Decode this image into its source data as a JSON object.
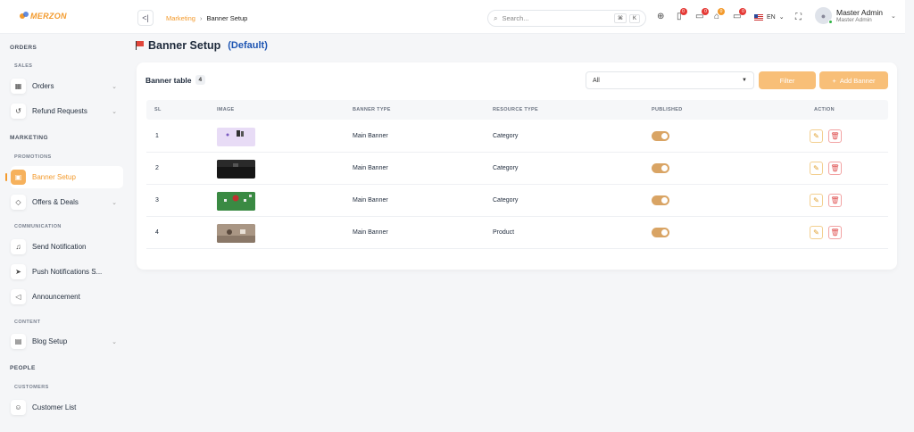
{
  "brand": {
    "name": "MERZON"
  },
  "breadcrumb": {
    "parent": "Marketing",
    "separator": "›",
    "current": "Banner Setup"
  },
  "search": {
    "placeholder": "Search...",
    "key1": "⌘",
    "key2": "K"
  },
  "notifications": {
    "cart_count": "0",
    "messages_count": "0",
    "store_count": "0",
    "card_count": "0"
  },
  "language": {
    "code": "EN"
  },
  "user": {
    "name": "Master Admin",
    "role": "Master Admin"
  },
  "sidebar": {
    "orders_section": "ORDERS",
    "sales_sub": "SALES",
    "orders": "Orders",
    "refund": "Refund Requests",
    "marketing_section": "MARKETING",
    "promotions_sub": "PROMOTIONS",
    "banner_setup": "Banner Setup",
    "offers": "Offers & Deals",
    "communication_sub": "COMMUNICATION",
    "send_notification": "Send Notification",
    "push_notifications": "Push Notifications S...",
    "announcement": "Announcement",
    "content_sub": "CONTENT",
    "blog_setup": "Blog Setup",
    "people_section": "PEOPLE",
    "customers_sub": "CUSTOMERS",
    "customer_list": "Customer List"
  },
  "page": {
    "title": "Banner Setup",
    "subtitle": "(Default)"
  },
  "table": {
    "title": "Banner table",
    "count": "4",
    "filter_value": "All",
    "filter_button": "Filter",
    "add_button": "Add Banner",
    "columns": [
      "SL",
      "IMAGE",
      "BANNER TYPE",
      "RESOURCE TYPE",
      "PUBLISHED",
      "ACTION"
    ],
    "rows": [
      {
        "sl": "1",
        "banner_type": "Main Banner",
        "resource_type": "Category",
        "published": true
      },
      {
        "sl": "2",
        "banner_type": "Main Banner",
        "resource_type": "Category",
        "published": true
      },
      {
        "sl": "3",
        "banner_type": "Main Banner",
        "resource_type": "Category",
        "published": true
      },
      {
        "sl": "4",
        "banner_type": "Main Banner",
        "resource_type": "Product",
        "published": true
      }
    ]
  },
  "colors": {
    "accent": "#f39a2c",
    "button": "#f8bf78",
    "toggle": "#d9a464",
    "link": "#1f56b3"
  }
}
